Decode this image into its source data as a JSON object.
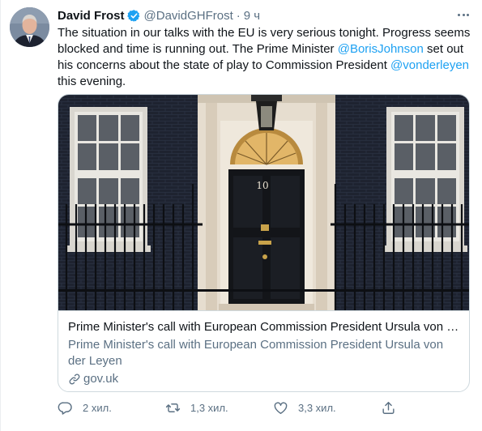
{
  "tweet": {
    "author_name": "David Frost",
    "handle": "@DavidGHFrost",
    "separator": "·",
    "time": "9 ч",
    "text": {
      "part1": "The situation in our talks with the EU is very serious tonight. Progress seems blocked and time is running out. The Prime Minister ",
      "mention1": "@BorisJohnson",
      "part2": " set out his concerns about the state of play to Commission President ",
      "mention2": "@vonderleyen",
      "part3": " this evening."
    },
    "card": {
      "title": "Prime Minister's call with European Commission President Ursula von d...",
      "description": "Prime Minister's call with European Commission President Ursula von der Leyen",
      "domain": "gov.uk",
      "door_number": "10"
    },
    "actions": {
      "replies": "2 хил.",
      "retweets": "1,3 хил.",
      "likes": "3,3 хил."
    }
  },
  "colors": {
    "accent": "#1da1f2",
    "secondary_text": "#5b7083",
    "border": "#cfd9de"
  },
  "icons": [
    "verified-badge-icon",
    "more-icon",
    "link-icon",
    "reply-icon",
    "retweet-icon",
    "like-icon",
    "share-icon"
  ]
}
